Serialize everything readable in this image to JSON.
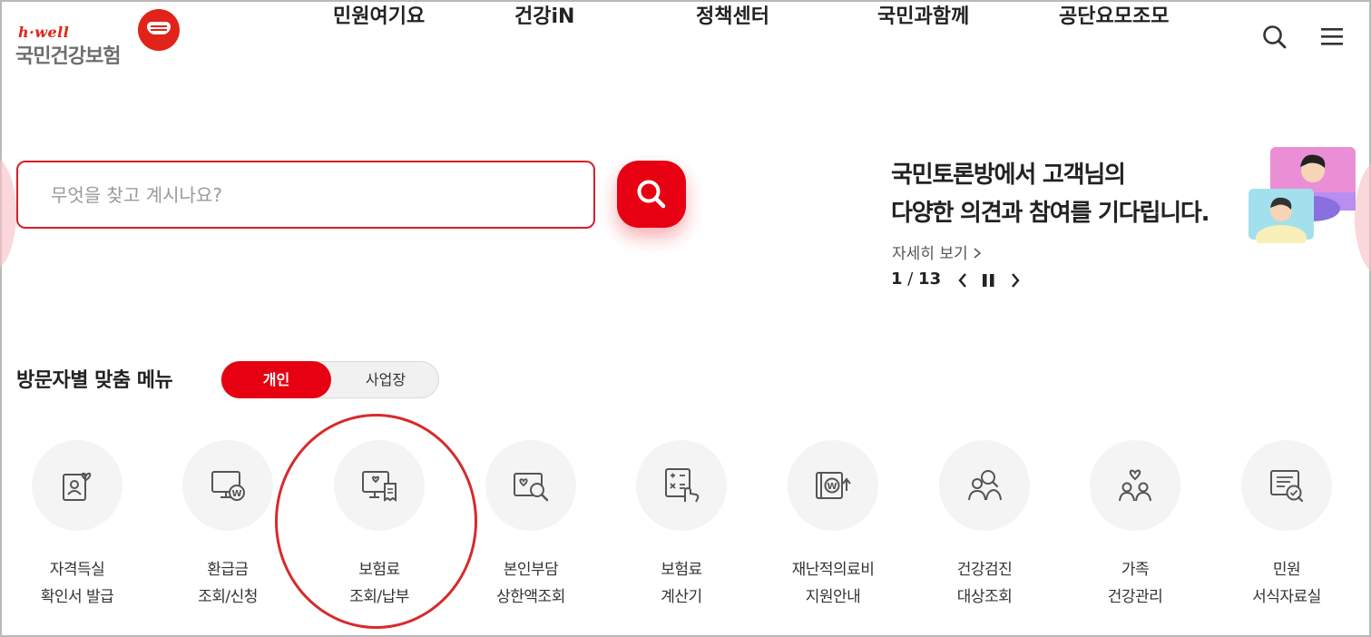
{
  "header": {
    "logo": {
      "tagline": "h·well",
      "name": "국민건강보험"
    },
    "nav": [
      "민원여기요",
      "건강iN",
      "정책센터",
      "국민과함께",
      "공단요모조모"
    ],
    "icons": [
      "search-icon",
      "hamburger-menu-icon"
    ]
  },
  "search": {
    "placeholder": "무엇을 찾고 계시나요?",
    "value": "",
    "button_icon": "search-icon"
  },
  "banner": {
    "line1": "국민토론방에서 고객님의",
    "line2": "다양한 의견과 참여를 기다립니다.",
    "more": "자세히 보기",
    "current": "1",
    "separator": " / ",
    "total": "13"
  },
  "custom_menu": {
    "title": "방문자별 맞춤 메뉴",
    "tabs": [
      "개인",
      "사업장"
    ],
    "active_tab": "개인",
    "items": [
      {
        "line1": "자격득실",
        "line2": "확인서 발급",
        "icon": "id-card-heart-icon"
      },
      {
        "line1": "환급금",
        "line2": "조회/신청",
        "icon": "monitor-won-icon"
      },
      {
        "line1": "보험료",
        "line2": "조회/납부",
        "icon": "pc-receipt-icon"
      },
      {
        "line1": "본인부담",
        "line2": "상한액조회",
        "icon": "heart-card-search-icon"
      },
      {
        "line1": "보험료",
        "line2": "계산기",
        "icon": "calculator-hand-icon"
      },
      {
        "line1": "재난적의료비",
        "line2": "지원안내",
        "icon": "wallet-won-up-icon"
      },
      {
        "line1": "건강검진",
        "line2": "대상조회",
        "icon": "people-search-icon"
      },
      {
        "line1": "가족",
        "line2": "건강관리",
        "icon": "family-heart-icon"
      },
      {
        "line1": "민원",
        "line2": "서식자료실",
        "icon": "document-check-icon"
      }
    ]
  },
  "colors": {
    "brand_red": "#e60012",
    "highlight_ring": "#d62b2b",
    "icon_stroke": "#555555",
    "circle_bg": "#f4f4f4"
  }
}
